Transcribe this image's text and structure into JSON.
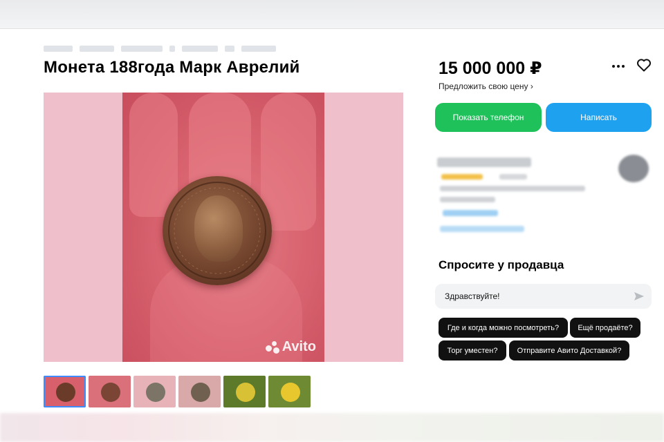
{
  "listing": {
    "title": "Монета 188года Марк Аврелий",
    "watermark": "Avito"
  },
  "sidebar": {
    "price": "15 000 000 ₽",
    "offer_price": "Предложить свою цену ›",
    "show_phone": "Показать телефон",
    "write": "Написать"
  },
  "ask": {
    "title": "Спросите у продавца",
    "input_value": "Здравствуйте!",
    "chips": [
      "Где и когда можно посмотреть?",
      "Ещё продаёте?",
      "Торг уместен?",
      "Отправите Авито Доставкой?"
    ]
  },
  "icons": {
    "more": "more-icon",
    "favorite": "heart-icon",
    "send": "send-icon"
  },
  "colors": {
    "green": "#1fc25a",
    "blue": "#1ea2f0",
    "chip": "#111111"
  }
}
